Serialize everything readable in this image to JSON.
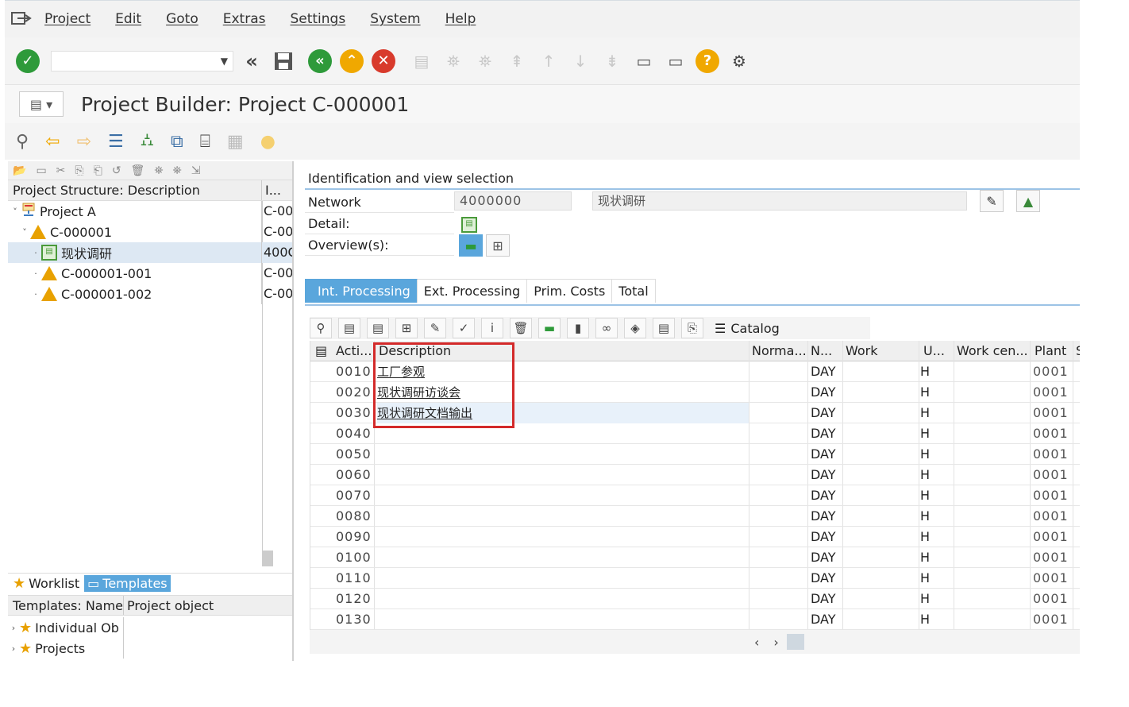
{
  "menu": [
    "Project",
    "Edit",
    "Goto",
    "Extras",
    "Settings",
    "System",
    "Help"
  ],
  "title": "Project Builder: Project C-000001",
  "left": {
    "tree_header": {
      "c1": "Project Structure: Description",
      "c2": "I..."
    },
    "tree": [
      {
        "label": "Project A",
        "code": "C-00",
        "level": 0,
        "icon": "project-icon",
        "expander": "˅"
      },
      {
        "label": "C-000001",
        "code": "C-00",
        "level": 1,
        "icon": "wbs-triangle-icon",
        "expander": "˅"
      },
      {
        "label": "现状调研",
        "code": "400C",
        "level": 2,
        "icon": "network-icon",
        "expander": "·",
        "selected": true
      },
      {
        "label": "C-000001-001",
        "code": "C-00",
        "level": 2,
        "icon": "wbs-triangle-icon",
        "expander": "·"
      },
      {
        "label": "C-000001-002",
        "code": "C-00",
        "level": 2,
        "icon": "wbs-triangle-icon",
        "expander": "·"
      }
    ],
    "tabs": {
      "worklist": "Worklist",
      "templates": "Templates"
    },
    "templates_header": {
      "c1": "Templates: Name",
      "c2": "Project object"
    },
    "templates": [
      {
        "label": "Individual Ob"
      },
      {
        "label": "Projects"
      }
    ]
  },
  "right": {
    "section_title": "Identification and view selection",
    "network_label": "Network",
    "network_value": "4000000",
    "network_desc": "现状调研",
    "detail_label": "Detail:",
    "overview_label": "Overview(s):",
    "tabs": [
      "Int. Processing",
      "Ext. Processing",
      "Prim. Costs",
      "Total"
    ],
    "catalog_label": "Catalog",
    "grid": {
      "headers": {
        "act": "Acti...",
        "desc": "Description",
        "norm": "Norma...",
        "n": "N...",
        "work": "Work",
        "u": "U...",
        "wc": "Work cen...",
        "plant": "Plant",
        "s": "S"
      },
      "rows": [
        {
          "act": "0010",
          "desc": "工厂参观",
          "unit": "DAY",
          "u": "H",
          "plant": "0001"
        },
        {
          "act": "0020",
          "desc": "现状调研访谈会",
          "unit": "DAY",
          "u": "H",
          "plant": "0001"
        },
        {
          "act": "0030",
          "desc": "现状调研文档输出",
          "unit": "DAY",
          "u": "H",
          "plant": "0001"
        },
        {
          "act": "0040",
          "desc": "",
          "unit": "DAY",
          "u": "H",
          "plant": "0001"
        },
        {
          "act": "0050",
          "desc": "",
          "unit": "DAY",
          "u": "H",
          "plant": "0001"
        },
        {
          "act": "0060",
          "desc": "",
          "unit": "DAY",
          "u": "H",
          "plant": "0001"
        },
        {
          "act": "0070",
          "desc": "",
          "unit": "DAY",
          "u": "H",
          "plant": "0001"
        },
        {
          "act": "0080",
          "desc": "",
          "unit": "DAY",
          "u": "H",
          "plant": "0001"
        },
        {
          "act": "0090",
          "desc": "",
          "unit": "DAY",
          "u": "H",
          "plant": "0001"
        },
        {
          "act": "0100",
          "desc": "",
          "unit": "DAY",
          "u": "H",
          "plant": "0001"
        },
        {
          "act": "0110",
          "desc": "",
          "unit": "DAY",
          "u": "H",
          "plant": "0001"
        },
        {
          "act": "0120",
          "desc": "",
          "unit": "DAY",
          "u": "H",
          "plant": "0001"
        },
        {
          "act": "0130",
          "desc": "",
          "unit": "DAY",
          "u": "H",
          "plant": "0001"
        }
      ]
    }
  },
  "colors": {
    "accent": "#5aa6dc",
    "highlight": "#d32a2a",
    "green": "#2e9a3a",
    "yellow": "#f0a800",
    "red": "#d83a2c"
  }
}
